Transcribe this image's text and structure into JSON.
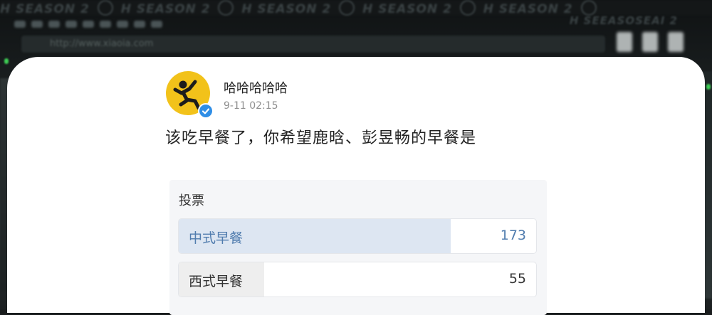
{
  "background": {
    "banner_text": "H SEASON 2",
    "banner_text_right": "H SEEASOSEAI 2",
    "address_text": "http://www.xiaoia.com"
  },
  "post": {
    "username": "哈哈哈哈哈",
    "timestamp": "9-11 02:15",
    "text": "该吃早餐了，你希望鹿晗、彭昱畅的早餐是",
    "verified": true
  },
  "poll": {
    "title": "投票",
    "options": [
      {
        "label": "中式早餐",
        "votes": "173",
        "share": 0.76,
        "selected": true
      },
      {
        "label": "西式早餐",
        "votes": "55",
        "share": 0.24,
        "selected": false
      }
    ]
  },
  "colors": {
    "avatar_bg": "#f2c21a",
    "verified_badge": "#2f8ee6",
    "selected_option_text": "#507cae",
    "selected_option_fill": "#dde6f2"
  },
  "icons": {
    "avatar": "running-figure-icon",
    "badge": "verified-check-icon"
  }
}
